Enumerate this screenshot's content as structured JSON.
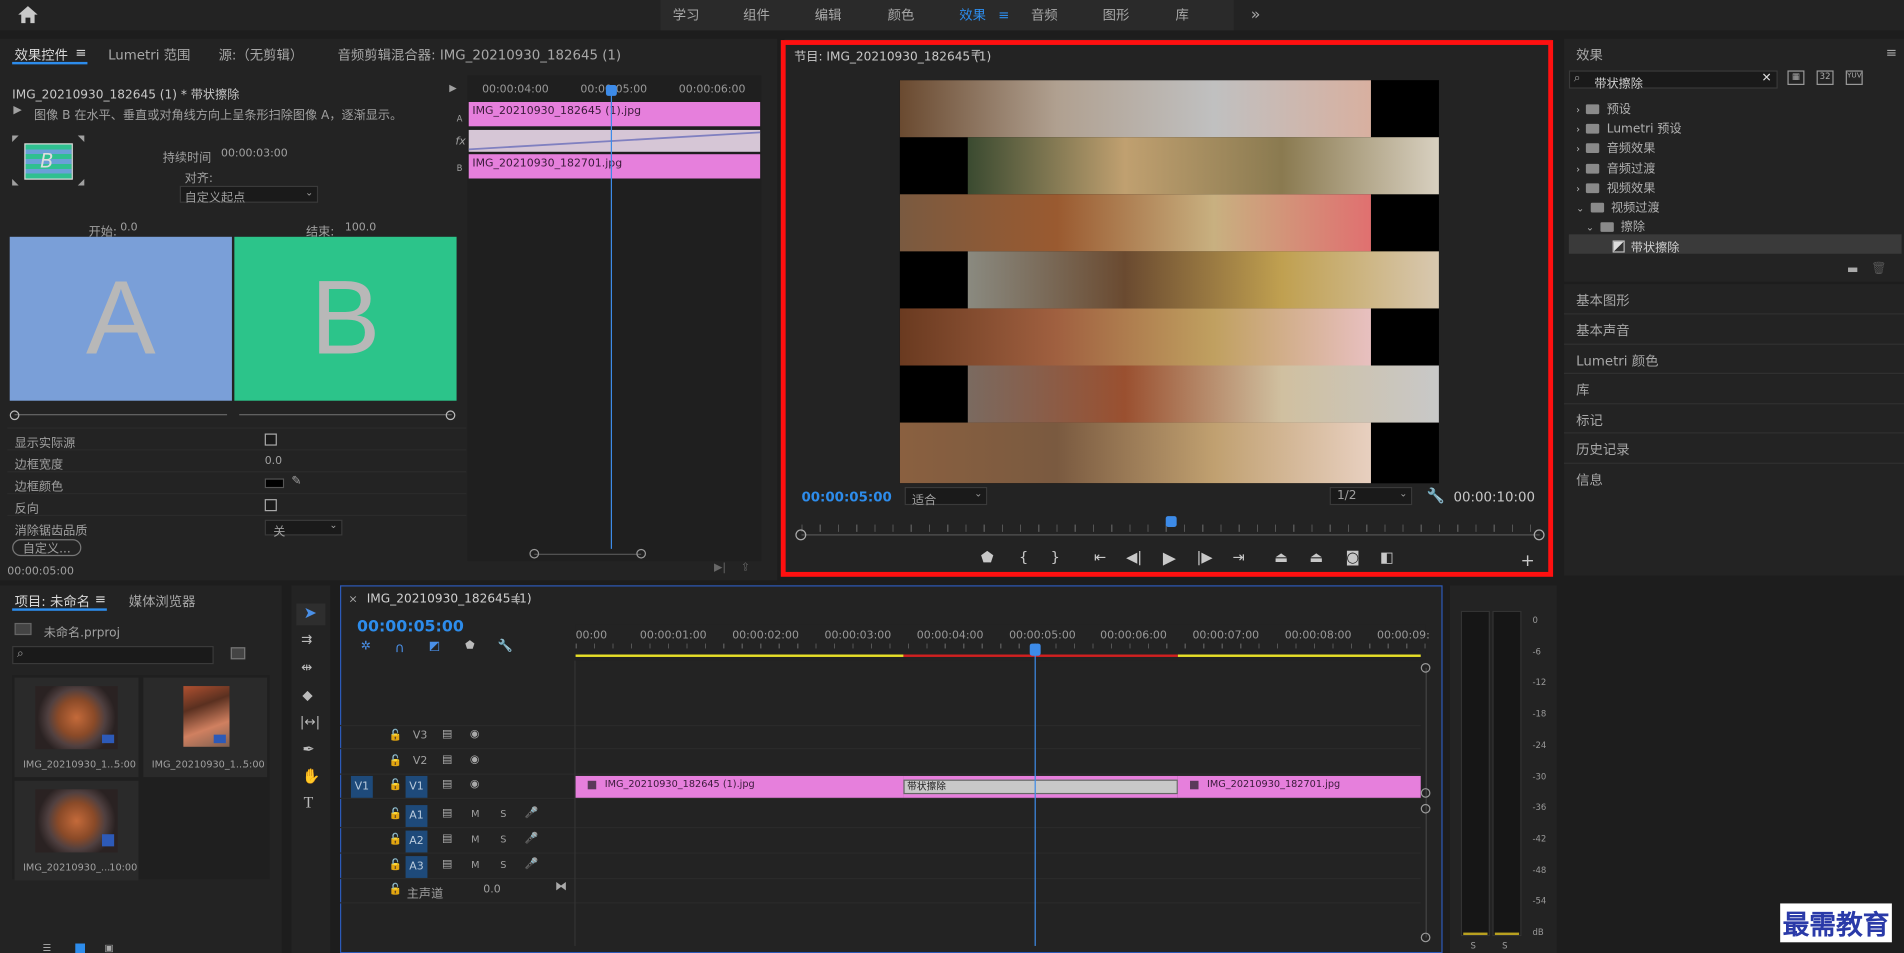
{
  "topbar": {
    "workspaces": [
      "学习",
      "组件",
      "编辑",
      "颜色",
      "效果",
      "音频",
      "图形",
      "库"
    ],
    "active": "效果"
  },
  "effect_controls": {
    "tabs": [
      "效果控件",
      "Lumetri 范围",
      "源:（无剪辑）",
      "音频剪辑混合器: IMG_20210930_182645 (1)"
    ],
    "clip_title": "IMG_20210930_182645 (1) * 带状擦除",
    "description": "图像 B 在水平、垂直或对角线方向上呈条形扫除图像 A，逐渐显示。",
    "duration_label": "持续时间",
    "duration_value": "00:00:03:00",
    "align_label": "对齐:",
    "align_value": "自定义起点",
    "start_label": "开始:",
    "start_value": "0.0",
    "end_label": "结束:",
    "end_value": "100.0",
    "preview_a": "A",
    "preview_b": "B",
    "params": [
      {
        "label": "显示实际源",
        "type": "checkbox"
      },
      {
        "label": "边框宽度",
        "value": "0.0"
      },
      {
        "label": "边框颜色",
        "type": "color"
      },
      {
        "label": "反向",
        "type": "checkbox"
      },
      {
        "label": "消除锯齿品质",
        "value": "关"
      }
    ],
    "custom_button": "自定义...",
    "timecode": "00:00:05:00",
    "mini_ruler": [
      "00:00:04:00",
      "00:00:05:00",
      "00:00:06:00"
    ],
    "clip_a": "IMG_20210930_182645 (1).jpg",
    "clip_b": "IMG_20210930_182701.jpg",
    "track_a": "A",
    "track_b": "B",
    "fx_label": "fx"
  },
  "program_monitor": {
    "title": "节目: IMG_20210930_182645 (1)",
    "current_time": "00:00:05:00",
    "fit_label": "适合",
    "resolution": "1/2",
    "duration": "00:00:10:00",
    "playhead_fraction": 0.5
  },
  "effects_panel": {
    "title": "效果",
    "search_value": "带状擦除",
    "tree": [
      {
        "label": "预设",
        "level": 0,
        "open": false
      },
      {
        "label": "Lumetri 预设",
        "level": 0,
        "open": false
      },
      {
        "label": "音频效果",
        "level": 0,
        "open": false
      },
      {
        "label": "音频过渡",
        "level": 0,
        "open": false
      },
      {
        "label": "视频效果",
        "level": 0,
        "open": false
      },
      {
        "label": "视频过渡",
        "level": 0,
        "open": true
      },
      {
        "label": "擦除",
        "level": 1,
        "open": true
      },
      {
        "label": "带状擦除",
        "level": 2,
        "selected": true
      }
    ],
    "sections": [
      "基本图形",
      "基本声音",
      "Lumetri 颜色",
      "库",
      "标记",
      "历史记录",
      "信息"
    ]
  },
  "project": {
    "tabs": [
      "项目: 未命名",
      "媒体浏览器"
    ],
    "file": "未命名.prproj",
    "items": [
      {
        "name": "IMG_20210930_1...",
        "duration": "5:00"
      },
      {
        "name": "IMG_20210930_1...",
        "duration": "5:00"
      },
      {
        "name": "IMG_20210930_...",
        "duration": "10:00"
      }
    ]
  },
  "timeline": {
    "tab": "IMG_20210930_182645 (1)",
    "timecode": "00:00:05:00",
    "ruler": [
      "00:00",
      "00:00:01:00",
      "00:00:02:00",
      "00:00:03:00",
      "00:00:04:00",
      "00:00:05:00",
      "00:00:06:00",
      "00:00:07:00",
      "00:00:08:00",
      "00:00:09:"
    ],
    "video_tracks": [
      "V3",
      "V2",
      "V1"
    ],
    "audio_tracks": [
      "A1",
      "A2",
      "A3"
    ],
    "source_patch": "V1",
    "mute": "M",
    "solo": "S",
    "master_label": "主声道",
    "master_value": "0.0",
    "clip1": "IMG_20210930_182645 (1).jpg",
    "transition": "带状擦除",
    "clip2": "IMG_20210930_182701.jpg"
  },
  "meter": {
    "scale": [
      "0",
      "-6",
      "-12",
      "-18",
      "-24",
      "-30",
      "-36",
      "-42",
      "-48",
      "-54",
      "dB"
    ],
    "solo": [
      "S",
      "S"
    ]
  },
  "watermark": "最需教育"
}
